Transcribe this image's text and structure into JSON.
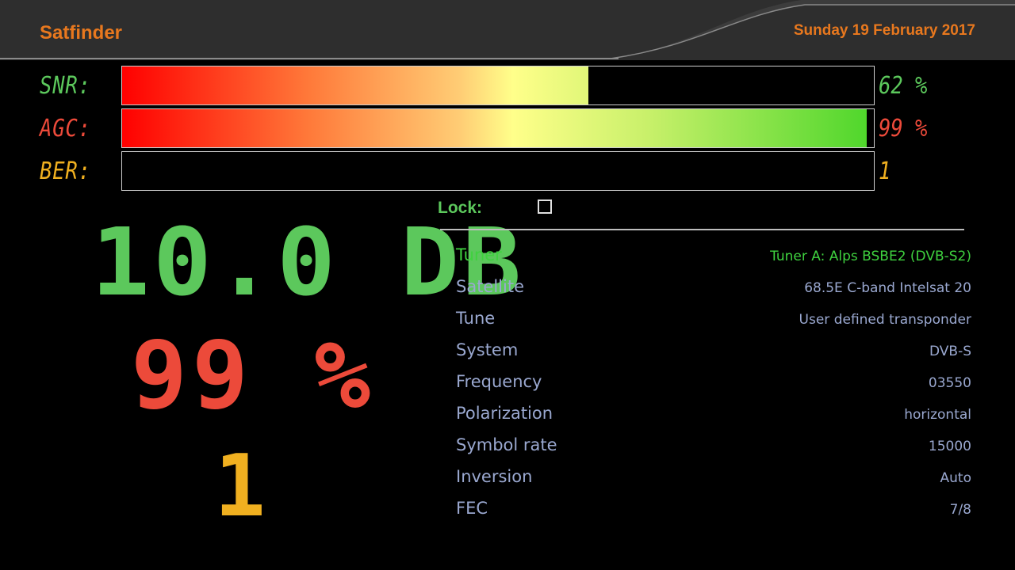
{
  "header": {
    "title": "Satfinder",
    "date": "Sunday 19 February 2017"
  },
  "colors": {
    "accent": "#e8781e",
    "snr": "#5cc85c",
    "agc": "#ec4a3a",
    "ber": "#f0b020",
    "info_text": "#9aa8d0",
    "highlight": "#3fd23f"
  },
  "meters": [
    {
      "name": "snr",
      "label": "SNR:",
      "value_text": "62 %",
      "level": 0.62,
      "color": "#5cc85c"
    },
    {
      "name": "agc",
      "label": "AGC:",
      "value_text": "99 %",
      "level": 0.99,
      "color": "#ec4a3a"
    },
    {
      "name": "ber",
      "label": "BER:",
      "value_text": "1",
      "level": 0.0,
      "color": "#f0b020"
    }
  ],
  "big_display": {
    "snr_db": "10.0 DB",
    "agc_percent": "99 %",
    "ber": "1"
  },
  "lock": {
    "label": "Lock:",
    "checked": false
  },
  "info": [
    {
      "key": "Tuner",
      "value": "Tuner A: Alps BSBE2 (DVB-S2)",
      "highlight": true
    },
    {
      "key": "Satellite",
      "value": "68.5E C-band Intelsat 20",
      "highlight": false
    },
    {
      "key": "Tune",
      "value": "User defined transponder",
      "highlight": false
    },
    {
      "key": "System",
      "value": "DVB-S",
      "highlight": false
    },
    {
      "key": "Frequency",
      "value": "03550",
      "highlight": false
    },
    {
      "key": "Polarization",
      "value": "horizontal",
      "highlight": false
    },
    {
      "key": "Symbol rate",
      "value": "15000",
      "highlight": false
    },
    {
      "key": "Inversion",
      "value": "Auto",
      "highlight": false
    },
    {
      "key": "FEC",
      "value": "7/8",
      "highlight": false
    }
  ]
}
